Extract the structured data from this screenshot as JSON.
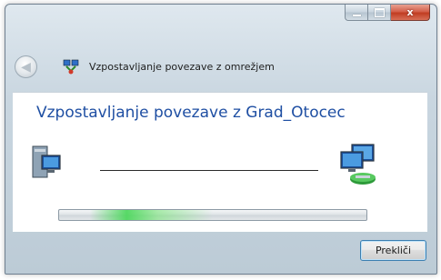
{
  "window": {
    "caption_buttons": {
      "minimize": "minimize-icon",
      "maximize": "maximize-icon",
      "close": "close-icon",
      "close_glyph": "x"
    }
  },
  "header": {
    "back_icon": "back-arrow-icon",
    "title_icon": "network-icon",
    "title": "Vzpostavljanje povezave z omrežjem"
  },
  "content": {
    "heading": "Vzpostavljanje povezave z Grad_Otocec",
    "left_icon": "computer-icon",
    "right_icon": "network-computers-icon",
    "progress_state": "indeterminate"
  },
  "footer": {
    "cancel_label": "Prekliči"
  },
  "colors": {
    "heading": "#1f4fa3",
    "progress_glow": "#48d758",
    "close_button": "#c13d22"
  }
}
